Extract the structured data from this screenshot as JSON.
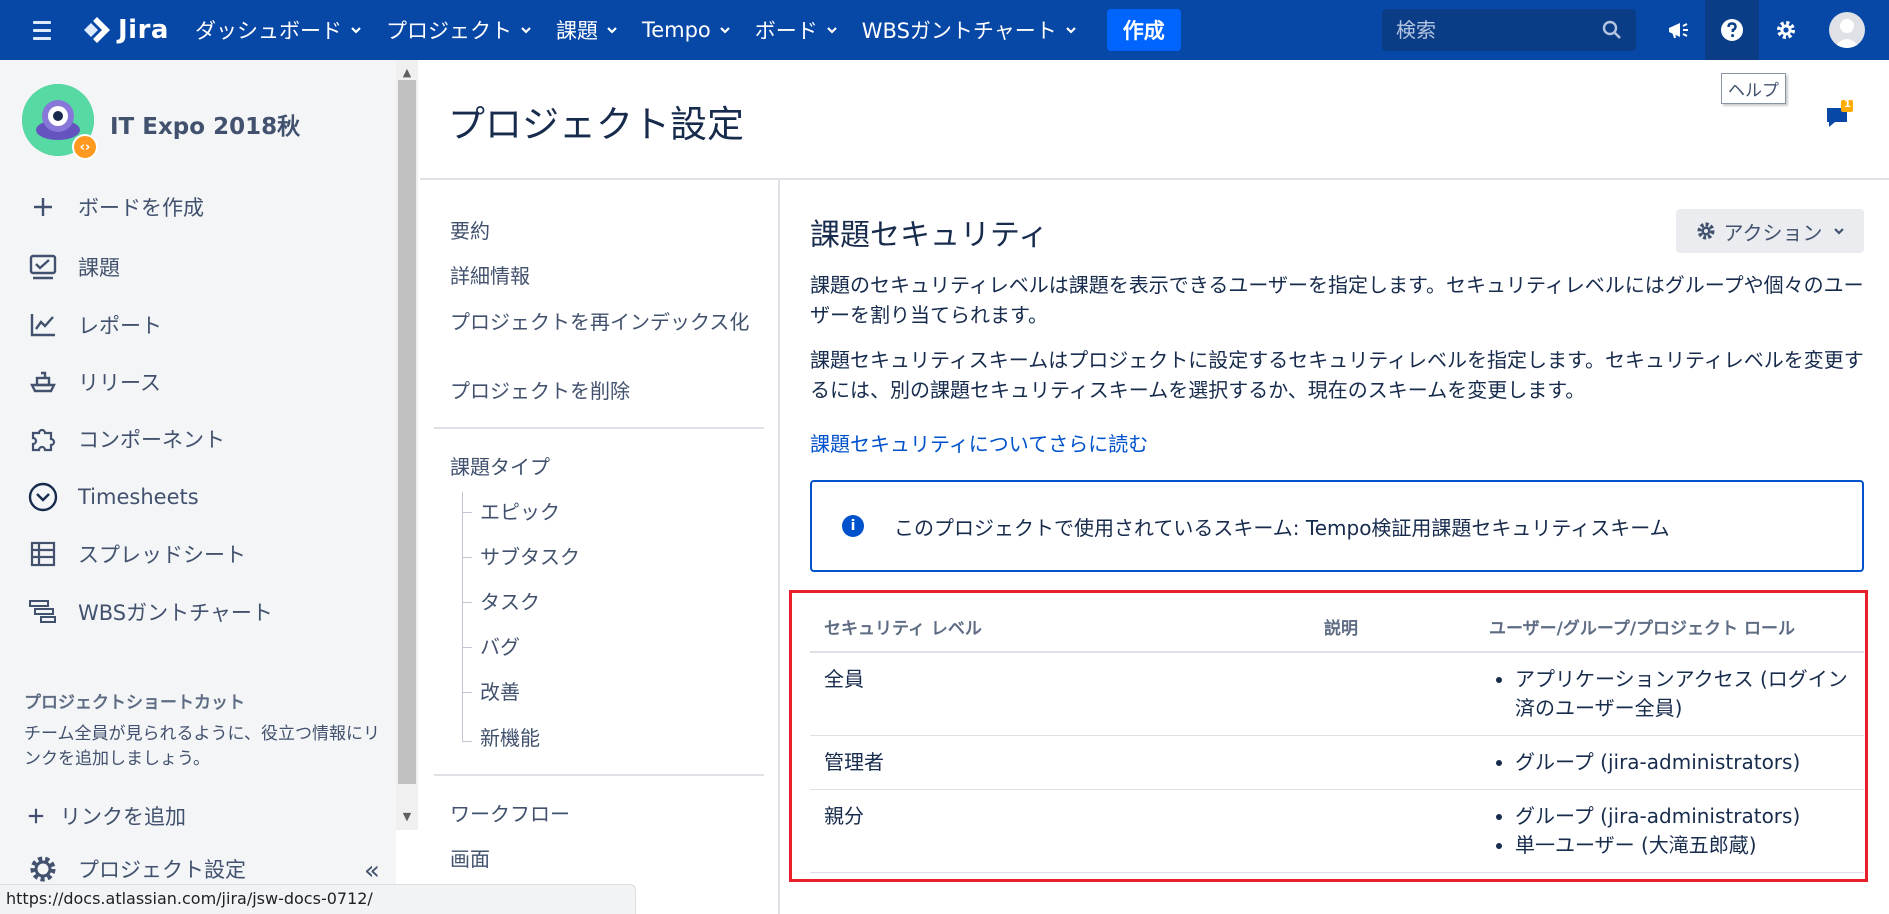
{
  "topnav": {
    "logo_text": "Jira",
    "items": [
      "ダッシュボード",
      "プロジェクト",
      "課題",
      "Tempo",
      "ボード",
      "WBSガントチャート"
    ],
    "create_label": "作成",
    "search_placeholder": "検索",
    "tooltip": "ヘルプ",
    "notification_count": "1"
  },
  "sidebar": {
    "project_name": "IT Expo 2018秋",
    "create_board": "ボードを作成",
    "items": [
      "課題",
      "レポート",
      "リリース",
      "コンポーネント",
      "Timesheets",
      "スプレッドシート",
      "WBSガントチャート"
    ],
    "shortcut_heading": "プロジェクトショートカット",
    "shortcut_desc": "チーム全員が見られるように、役立つ情報にリンクを追加しましょう。",
    "add_link": "リンクを追加",
    "project_settings": "プロジェクト設定"
  },
  "statusbar": "https://docs.atlassian.com/jira/jsw-docs-0712/",
  "main": {
    "page_title": "プロジェクト設定",
    "subnav": {
      "top": [
        "要約",
        "詳細情報",
        "プロジェクトを再インデックス化",
        "プロジェクトを削除"
      ],
      "issue_types": "課題タイプ",
      "issue_type_children": [
        "エピック",
        "サブタスク",
        "タスク",
        "バグ",
        "改善",
        "新機能"
      ],
      "bottom": [
        "ワークフロー",
        "画面"
      ]
    },
    "heading": "課題セキュリティ",
    "action_label": "アクション",
    "para1": "課題のセキュリティレベルは課題を表示できるユーザーを指定します。セキュリティレベルにはグループや個々のユーザーを割り当てられます。",
    "para2": "課題セキュリティスキームはプロジェクトに設定するセキュリティレベルを指定します。セキュリティレベルを変更するには、別の課題セキュリティスキームを選択するか、現在のスキームを変更します。",
    "learn_more": "課題セキュリティについてさらに読む",
    "info": "このプロジェクトで使用されているスキーム: Tempo検証用課題セキュリティスキーム",
    "table": {
      "headers": [
        "セキュリティ レベル",
        "説明",
        "ユーザー/グループ/プロジェクト ロール"
      ],
      "rows": [
        {
          "level": "全員",
          "desc": "",
          "members": [
            "アプリケーションアクセス (ログイン済のユーザー全員)"
          ]
        },
        {
          "level": "管理者",
          "desc": "",
          "members": [
            "グループ (jira-administrators)"
          ]
        },
        {
          "level": "親分",
          "desc": "",
          "members": [
            "グループ (jira-administrators)",
            "単一ユーザー (大滝五郎蔵)"
          ]
        }
      ]
    }
  }
}
